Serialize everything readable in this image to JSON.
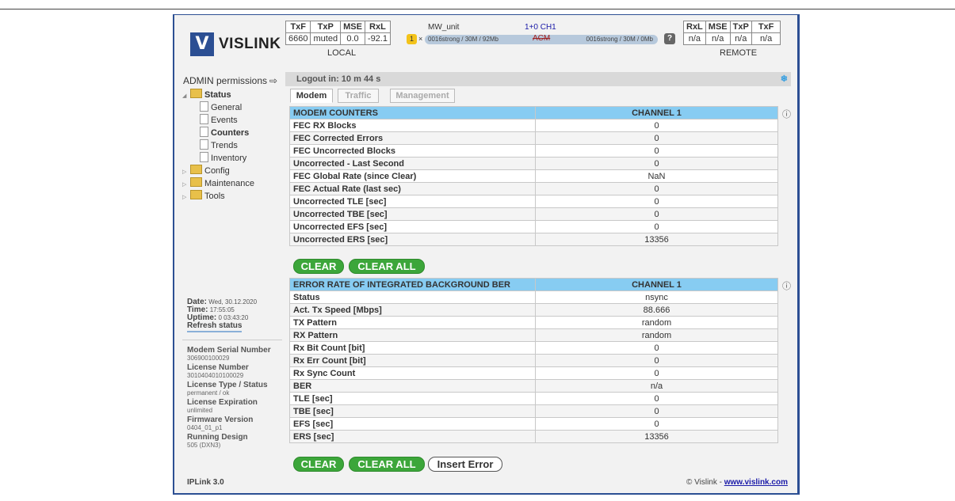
{
  "brand": {
    "logo_glyph": "V",
    "name": "VISLINK"
  },
  "local": {
    "headers": [
      "TxF",
      "TxP",
      "MSE",
      "RxL"
    ],
    "values": [
      "6660",
      "muted",
      "0.0",
      "-92.1"
    ],
    "label": "LOCAL"
  },
  "remote": {
    "headers": [
      "RxL",
      "MSE",
      "TxP",
      "TxF"
    ],
    "values": [
      "n/a",
      "n/a",
      "n/a",
      "n/a"
    ],
    "label": "REMOTE"
  },
  "link": {
    "unit": "MW_unit",
    "channel": "1+0 CH1",
    "count_badge": "1",
    "multiplier": "×",
    "left_rate": "0016strong / 30M / 92Mb",
    "mode": "ACM",
    "right_rate": "0016strong / 30M / 0Mb",
    "help": "?"
  },
  "permissions": {
    "label": "ADMIN permissions",
    "logout_icon": "⇨"
  },
  "tree": {
    "status": "Status",
    "status_children": [
      "General",
      "Events",
      "Counters",
      "Trends",
      "Inventory"
    ],
    "others": [
      "Config",
      "Maintenance",
      "Tools"
    ]
  },
  "session": {
    "logout_text": "Logout in: 10 m 44 s"
  },
  "tabs": [
    "Modem",
    "Traffic",
    "Management"
  ],
  "modem_counters": {
    "header": "MODEM COUNTERS",
    "channel": "CHANNEL 1",
    "rows": [
      {
        "label": "FEC RX Blocks",
        "value": "0"
      },
      {
        "label": "FEC Corrected Errors",
        "value": "0"
      },
      {
        "label": "FEC Uncorrected Blocks",
        "value": "0"
      },
      {
        "label": "Uncorrected - Last Second",
        "value": "0"
      },
      {
        "label": "FEC Global Rate (since Clear)",
        "value": "NaN"
      },
      {
        "label": "FEC Actual Rate (last sec)",
        "value": "0"
      },
      {
        "label": "Uncorrected TLE [sec]",
        "value": "0"
      },
      {
        "label": "Uncorrected TBE [sec]",
        "value": "0"
      },
      {
        "label": "Uncorrected EFS [sec]",
        "value": "0"
      },
      {
        "label": "Uncorrected ERS [sec]",
        "value": "13356"
      }
    ]
  },
  "ber": {
    "header": "ERROR RATE OF INTEGRATED BACKGROUND BER",
    "channel": "CHANNEL 1",
    "rows": [
      {
        "label": "Status",
        "value": "nsync"
      },
      {
        "label": "Act. Tx Speed [Mbps]",
        "value": "88.666"
      },
      {
        "label": "TX Pattern",
        "value": "random"
      },
      {
        "label": "RX Pattern",
        "value": "random"
      },
      {
        "label": "Rx Bit Count [bit]",
        "value": "0"
      },
      {
        "label": "Rx Err Count [bit]",
        "value": "0"
      },
      {
        "label": "Rx Sync Count",
        "value": "0"
      },
      {
        "label": "BER",
        "value": "n/a"
      },
      {
        "label": "TLE [sec]",
        "value": "0"
      },
      {
        "label": "TBE [sec]",
        "value": "0"
      },
      {
        "label": "EFS [sec]",
        "value": "0"
      },
      {
        "label": "ERS [sec]",
        "value": "13356"
      }
    ]
  },
  "buttons": {
    "clear": "CLEAR",
    "clear_all": "CLEAR ALL",
    "insert_error": "Insert Error"
  },
  "system": {
    "date_label": "Date:",
    "date": "Wed, 30.12.2020",
    "time_label": "Time:",
    "time": "17:55:05",
    "uptime_label": "Uptime:",
    "uptime": "0 03:43:20",
    "refresh": "Refresh status"
  },
  "device": [
    {
      "k": "Modem Serial Number",
      "v": "306900100029"
    },
    {
      "k": "License Number",
      "v": "3010404010100029"
    },
    {
      "k": "License Type / Status",
      "v": "permanent / ok"
    },
    {
      "k": "License Expiration",
      "v": "unlimited"
    },
    {
      "k": "Firmware Version",
      "v": "0404_01_p1"
    },
    {
      "k": "Running Design",
      "v": "505 (DXN3)"
    }
  ],
  "footer": {
    "version": "IPLink 3.0",
    "copyright": "© Vislink - ",
    "link": "www.vislink.com"
  },
  "colors": {
    "frame": "#2c4f93",
    "table_header": "#87ccf2",
    "button_green": "#3ca63a",
    "badge_yellow": "#f3c31a"
  }
}
